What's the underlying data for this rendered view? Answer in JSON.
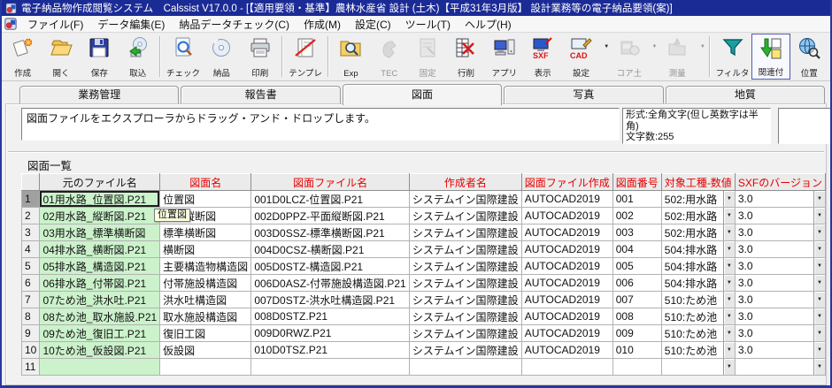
{
  "window": {
    "title": "電子納品物作成閲覧システム　Calssist V17.0.0 - [【適用要領・基準】農林水産省 設計 (土木)【平成31年3月版】 設計業務等の電子納品要領(案)]"
  },
  "menu": {
    "items": [
      "ファイル(F)",
      "データ編集(E)",
      "納品データチェック(C)",
      "作成(M)",
      "設定(C)",
      "ツール(T)",
      "ヘルプ(H)"
    ]
  },
  "toolbar": {
    "buttons": [
      {
        "label": "作成",
        "icon": "new-document-icon",
        "enabled": true,
        "dropdown": false,
        "active": false,
        "sep_after": false
      },
      {
        "label": "開く",
        "icon": "open-folder-icon",
        "enabled": true,
        "dropdown": false,
        "active": false,
        "sep_after": false
      },
      {
        "label": "保存",
        "icon": "save-floppy-icon",
        "enabled": true,
        "dropdown": false,
        "active": false,
        "sep_after": false
      },
      {
        "label": "取込",
        "icon": "import-cd-icon",
        "enabled": true,
        "dropdown": false,
        "active": false,
        "sep_after": true
      },
      {
        "label": "チェック",
        "icon": "check-document-icon",
        "enabled": true,
        "dropdown": false,
        "active": false,
        "sep_after": false
      },
      {
        "label": "納品",
        "icon": "delivery-cd-icon",
        "enabled": true,
        "dropdown": false,
        "active": false,
        "sep_after": false
      },
      {
        "label": "印刷",
        "icon": "print-icon",
        "enabled": true,
        "dropdown": false,
        "active": false,
        "sep_after": true
      },
      {
        "label": "テンプレ",
        "icon": "template-icon",
        "enabled": true,
        "dropdown": false,
        "active": false,
        "sep_after": true
      },
      {
        "label": "Exp",
        "icon": "explorer-folder-icon",
        "enabled": true,
        "dropdown": false,
        "active": false,
        "sep_after": false
      },
      {
        "label": "TEC",
        "icon": "tec-icon",
        "enabled": false,
        "dropdown": false,
        "active": false,
        "sep_after": false
      },
      {
        "label": "固定",
        "icon": "fixed-document-icon",
        "enabled": false,
        "dropdown": false,
        "active": false,
        "sep_after": false
      },
      {
        "label": "行削",
        "icon": "delete-row-icon",
        "enabled": true,
        "dropdown": false,
        "active": false,
        "sep_after": false
      },
      {
        "label": "アプリ",
        "icon": "app-computer-icon",
        "enabled": true,
        "dropdown": false,
        "active": false,
        "sep_after": false
      },
      {
        "label": "表示",
        "icon": "sxf-view-icon",
        "enabled": true,
        "dropdown": false,
        "active": false,
        "sep_after": false
      },
      {
        "label": "設定",
        "icon": "cad-settings-icon",
        "enabled": true,
        "dropdown": true,
        "active": false,
        "sep_after": false
      },
      {
        "label": "コア土",
        "icon": "core-soil-icon",
        "enabled": false,
        "dropdown": true,
        "active": false,
        "sep_after": false
      },
      {
        "label": "測量",
        "icon": "survey-icon",
        "enabled": false,
        "dropdown": true,
        "active": false,
        "sep_after": true
      },
      {
        "label": "フィルタ",
        "icon": "filter-icon",
        "enabled": true,
        "dropdown": false,
        "active": false,
        "sep_after": false
      },
      {
        "label": "関連付",
        "icon": "associate-icon",
        "enabled": true,
        "dropdown": false,
        "active": true,
        "sep_after": false
      },
      {
        "label": "位置",
        "icon": "location-icon",
        "enabled": true,
        "dropdown": false,
        "active": false,
        "sep_after": false
      }
    ]
  },
  "tabs": {
    "items": [
      "業務管理",
      "報告書",
      "図面",
      "写真",
      "地質"
    ],
    "selected": "図面"
  },
  "drawing_tab": {
    "drop_hint": "図面ファイルをエクスプローラからドラッグ・アンド・ドロップします。"
  },
  "format_info": {
    "line1": "形式:全角文字(但し英数字は半角)",
    "line2": "文字数:255"
  },
  "tooltip": {
    "text": "位置図"
  },
  "table": {
    "caption": "図面一覧",
    "columns": [
      {
        "label": "",
        "red": false
      },
      {
        "label": "元のファイル名",
        "red": false
      },
      {
        "label": "図面名",
        "red": true
      },
      {
        "label": "図面ファイル名",
        "red": true
      },
      {
        "label": "作成者名",
        "red": true
      },
      {
        "label": "図面ファイル作成",
        "red": true
      },
      {
        "label": "図面番号",
        "red": true
      },
      {
        "label": "対象工種-数値",
        "red": true
      },
      {
        "label": "SXFのバージョン",
        "red": true
      }
    ],
    "rows": [
      [
        "1",
        "01用水路_位置図.P21",
        "位置図",
        "001D0LCZ-位置図.P21",
        "システムイン国際建設",
        "AUTOCAD2019",
        "001",
        "502:用水路",
        "3.0"
      ],
      [
        "2",
        "02用水路_縦断図.P21",
        "平面縦断図",
        "002D0PPZ-平面縦断図.P21",
        "システムイン国際建設",
        "AUTOCAD2019",
        "002",
        "502:用水路",
        "3.0"
      ],
      [
        "3",
        "03用水路_標準横断図",
        "標準横断図",
        "003D0SSZ-標準横断図.P21",
        "システムイン国際建設",
        "AUTOCAD2019",
        "003",
        "502:用水路",
        "3.0"
      ],
      [
        "4",
        "04排水路_横断図.P21",
        "横断図",
        "004D0CSZ-横断図.P21",
        "システムイン国際建設",
        "AUTOCAD2019",
        "004",
        "504:排水路",
        "3.0"
      ],
      [
        "5",
        "05排水路_構造図.P21",
        "主要構造物構造図",
        "005D0STZ-構造図.P21",
        "システムイン国際建設",
        "AUTOCAD2019",
        "005",
        "504:排水路",
        "3.0"
      ],
      [
        "6",
        "06排水路_付帯図.P21",
        "付帯施設構造図",
        "006D0ASZ-付帯施設構造図.P21",
        "システムイン国際建設",
        "AUTOCAD2019",
        "006",
        "504:排水路",
        "3.0"
      ],
      [
        "7",
        "07ため池_洪水吐.P21",
        "洪水吐構造図",
        "007D0STZ-洪水吐構造図.P21",
        "システムイン国際建設",
        "AUTOCAD2019",
        "007",
        "510:ため池",
        "3.0"
      ],
      [
        "8",
        "08ため池_取水施設.P21",
        "取水施設構造図",
        "008D0STZ.P21",
        "システムイン国際建設",
        "AUTOCAD2019",
        "008",
        "510:ため池",
        "3.0"
      ],
      [
        "9",
        "09ため池_復旧工.P21",
        "復旧工図",
        "009D0RWZ.P21",
        "システムイン国際建設",
        "AUTOCAD2019",
        "009",
        "510:ため池",
        "3.0"
      ],
      [
        "10",
        "10ため池_仮設図.P21",
        "仮設図",
        "010D0TSZ.P21",
        "システムイン国際建設",
        "AUTOCAD2019",
        "010",
        "510:ため池",
        "3.0"
      ],
      [
        "11",
        "",
        "",
        "",
        "",
        "",
        "",
        "",
        ""
      ]
    ],
    "selected_row": "1"
  },
  "colors": {
    "titlebar_bg": "#1b2b96",
    "window_border": "#2636a4",
    "header_red": "#e60000",
    "fixed_cell_green": "#ccf2cc",
    "selected_row_header": "#a0a0a0",
    "tooltip_bg": "#ffffe1"
  }
}
